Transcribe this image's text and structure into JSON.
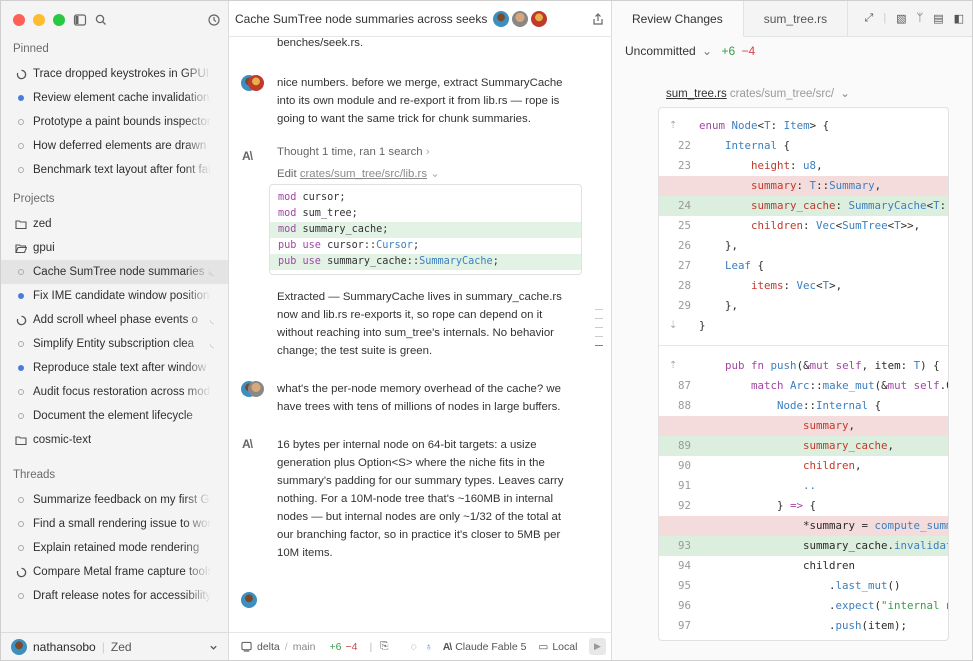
{
  "sidebar": {
    "pinned_heading": "Pinned",
    "pinned": [
      {
        "label": "Trace dropped keystrokes in GPUI in",
        "status": "running"
      },
      {
        "label": "Review element cache invalidation n",
        "status": "unread"
      },
      {
        "label": "Prototype a paint bounds inspector",
        "status": "idle"
      },
      {
        "label": "How deferred elements are drawn",
        "status": "idle"
      },
      {
        "label": "Benchmark text layout after font fall",
        "status": "idle"
      }
    ],
    "projects_heading": "Projects",
    "projects": [
      {
        "label": "zed",
        "kind": "folder"
      },
      {
        "label": "gpui",
        "kind": "folder-open"
      },
      {
        "label": "Cache SumTree node summaries ac",
        "status": "idle",
        "active": true,
        "rss": true
      },
      {
        "label": "Fix IME candidate window positionin",
        "status": "unread"
      },
      {
        "label": "Add scroll wheel phase events o",
        "status": "running",
        "rss": true
      },
      {
        "label": "Simplify Entity subscription clea",
        "status": "idle",
        "rss": true
      },
      {
        "label": "Reproduce stale text after window r",
        "status": "unread"
      },
      {
        "label": "Audit focus restoration across moda",
        "status": "idle"
      },
      {
        "label": "Document the element lifecycle",
        "status": "idle"
      },
      {
        "label": "cosmic-text",
        "kind": "folder"
      }
    ],
    "threads_heading": "Threads",
    "threads": [
      {
        "label": "Summarize feedback on my first GPU",
        "status": "idle"
      },
      {
        "label": "Find a small rendering issue to work",
        "status": "idle"
      },
      {
        "label": "Explain retained mode rendering",
        "status": "idle"
      },
      {
        "label": "Compare Metal frame capture tools",
        "status": "running"
      },
      {
        "label": "Draft release notes for accessibility f",
        "status": "idle"
      }
    ],
    "footer": {
      "user": "nathansobo",
      "app": "Zed"
    }
  },
  "thread": {
    "title": "Cache SumTree node summaries across seeks",
    "top_text": "benches/seek.rs.",
    "msg1": "nice numbers. before we merge, extract SummaryCache into its own module and re-export it from lib.rs — rope is going to want the same trick for chunk summaries.",
    "thought": "Thought 1 time, ran 1 search",
    "edit_prefix": "Edit",
    "edit_path": "crates/sum_tree/src/lib.rs",
    "code": [
      {
        "kw": "mod",
        "rest": " cursor;",
        "added": false
      },
      {
        "kw": "mod",
        "rest": " sum_tree;",
        "added": false
      },
      {
        "kw": "mod",
        "rest": " summary_cache;",
        "added": true
      },
      {
        "kw": "pub use",
        "rest": " cursor::",
        "ty": "Cursor",
        "end": ";",
        "added": false
      },
      {
        "kw": "pub use",
        "rest": " summary_cache::",
        "ty": "SummaryCache",
        "end": ";",
        "added": true
      }
    ],
    "reply1": "Extracted — SummaryCache lives in summary_cache.rs now and lib.rs re-exports it, so rope can depend on it without reaching into sum_tree's internals. No behavior change; the test suite is green.",
    "msg2": "what's the per-node memory overhead of the cache? we have trees with tens of millions of nodes in large buffers.",
    "reply2": "16 bytes per internal node on 64-bit targets: a usize generation plus Option<S> where the niche fits in the summary's padding for our summary types. Leaves carry nothing. For a 10M-node tree that's ~160MB in internal nodes — but internal nodes are only ~1/32 of the total at our branching factor, so in practice it's closer to 5MB per 10M items.",
    "footer": {
      "branch": "delta",
      "base": "main",
      "added": "+6",
      "removed": "−4",
      "model": "Claude Fable 5",
      "mode": "Local"
    }
  },
  "review": {
    "tabs": [
      "Review Changes",
      "sum_tree.rs"
    ],
    "uncommitted": "Uncommitted",
    "added": "+6",
    "removed": "−4",
    "file_name": "sum_tree.rs",
    "file_path": "crates/sum_tree/src/",
    "diff": [
      {
        "num": "",
        "kind": "ctx",
        "html": "<span class='c-kw'>enum</span> <span class='c-ty'>Node</span>&lt;<span class='c-ty'>T</span>: <span class='c-ty'>Item</span>&gt; {"
      },
      {
        "num": "22",
        "kind": "ctx",
        "html": "    <span class='c-ty'>Internal</span> {"
      },
      {
        "num": "23",
        "kind": "ctx",
        "html": "        <span class='c-fd'>height</span>: <span class='c-ty'>u8</span>,"
      },
      {
        "num": "",
        "kind": "del",
        "html": "        <span class='c-fd'>summary</span>: <span class='c-ty'>T</span>::<span class='c-ty'>Summary</span>,"
      },
      {
        "num": "24",
        "kind": "add",
        "html": "        <span class='c-fd'>summary_cache</span>: <span class='c-ty'>SummaryCache</span>&lt;<span class='c-ty'>T</span>::<span class='c-ty'>Summary</span>&gt;,"
      },
      {
        "num": "25",
        "kind": "ctx",
        "html": "        <span class='c-fd'>children</span>: <span class='c-ty'>Vec</span>&lt;<span class='c-ty'>SumTree</span>&lt;<span class='c-ty'>T</span>&gt;&gt;,"
      },
      {
        "num": "26",
        "kind": "ctx",
        "html": "    },"
      },
      {
        "num": "27",
        "kind": "ctx",
        "html": "    <span class='c-ty'>Leaf</span> {"
      },
      {
        "num": "28",
        "kind": "ctx",
        "html": "        <span class='c-fd'>items</span>: <span class='c-ty'>Vec</span>&lt;<span class='c-ty'>T</span>&gt;,"
      },
      {
        "num": "29",
        "kind": "ctx",
        "html": "    },"
      },
      {
        "num": "",
        "kind": "ctx",
        "html": "}"
      },
      {
        "num": "",
        "kind": "ctx",
        "html": "    <span class='c-kw'>pub fn</span> <span class='c-fn'>push</span>(&amp;<span class='c-kw'>mut self</span>, item: <span class='c-ty'>T</span>) {"
      },
      {
        "num": "87",
        "kind": "ctx",
        "html": "        <span class='c-kw'>match</span> <span class='c-ty'>Arc</span>::<span class='c-fn'>make_mut</span>(&amp;<span class='c-kw'>mut self</span>.0) {"
      },
      {
        "num": "88",
        "kind": "ctx",
        "html": "            <span class='c-ty'>Node</span>::<span class='c-ty'>Internal</span> {"
      },
      {
        "num": "",
        "kind": "del",
        "html": "                <span class='c-fd'>summary</span>,"
      },
      {
        "num": "89",
        "kind": "add",
        "html": "                <span class='c-fd'>summary_cache</span>,"
      },
      {
        "num": "90",
        "kind": "ctx",
        "html": "                <span class='c-fd'>children</span>,"
      },
      {
        "num": "91",
        "kind": "ctx",
        "html": "                <span class='c-ty'>..</span>"
      },
      {
        "num": "92",
        "kind": "ctx",
        "html": "            } <span class='c-kw'>=&gt;</span> {"
      },
      {
        "num": "",
        "kind": "del",
        "html": "                *summary = <span class='c-fn'>compute_summary</span>(children);"
      },
      {
        "num": "93",
        "kind": "add",
        "html": "                summary_cache.<span class='c-fn'>invalidate</span>();"
      },
      {
        "num": "94",
        "kind": "ctx",
        "html": "                children"
      },
      {
        "num": "95",
        "kind": "ctx",
        "html": "                    .<span class='c-fn'>last_mut</span>()"
      },
      {
        "num": "96",
        "kind": "ctx",
        "html": "                    .<span class='c-fn'>expect</span>(<span class='c-st'>\"internal nodes have children\"</span>)"
      },
      {
        "num": "97",
        "kind": "ctx",
        "html": "                    .<span class='c-fn'>push</span>(item);"
      }
    ]
  }
}
